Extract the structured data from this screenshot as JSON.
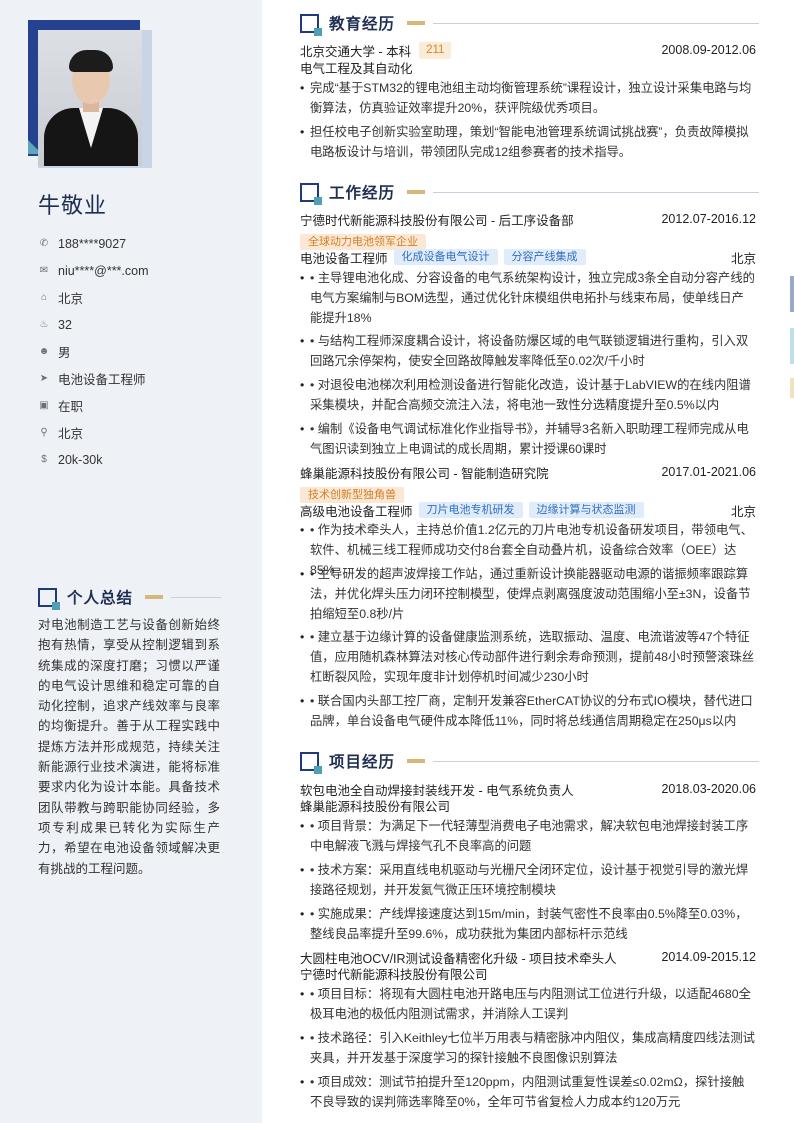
{
  "profile": {
    "name": "牛敬业",
    "info": [
      {
        "icon": "phone-icon",
        "glyph": "✆",
        "text": "188****9027"
      },
      {
        "icon": "mail-icon",
        "glyph": "✉",
        "text": "niu****@***.com"
      },
      {
        "icon": "home-icon",
        "glyph": "⌂",
        "text": "北京"
      },
      {
        "icon": "cake-icon",
        "glyph": "♨",
        "text": "32"
      },
      {
        "icon": "gender-icon",
        "glyph": "☻",
        "text": "男"
      },
      {
        "icon": "send-icon",
        "glyph": "➤",
        "text": "电池设备工程师"
      },
      {
        "icon": "briefcase-icon",
        "glyph": "▣",
        "text": "在职"
      },
      {
        "icon": "location-icon",
        "glyph": "⚲",
        "text": "北京"
      },
      {
        "icon": "salary-icon",
        "glyph": "$",
        "text": "20k-30k"
      }
    ]
  },
  "summary": {
    "title": "个人总结",
    "text": "对电池制造工艺与设备创新始终抱有热情，享受从控制逻辑到系统集成的深度打磨；习惯以严谨的电气设计思维和稳定可靠的自动化控制，追求产线效率与良率的均衡提升。善于从工程实践中提炼方法并形成规范，持续关注新能源行业技术演进，能将标准要求内化为设计本能。具备技术团队带教与跨职能协同经验，多项专利成果已转化为实际生产力，希望在电池设备领域解决更有挑战的工程问题。"
  },
  "education": {
    "title": "教育经历",
    "school": "北京交通大学 - 本科",
    "tag": "211",
    "date": "2008.09-2012.06",
    "major": "电气工程及其自动化",
    "bullets": [
      "完成“基于STM32的锂电池组主动均衡管理系统”课程设计，独立设计采集电路与均衡算法，仿真验证效率提升20%，获评院级优秀项目。",
      "担任校电子创新实验室助理，策划“智能电池管理系统调试挑战赛”，负责故障模拟电路板设计与培训，带领团队完成12组参赛者的技术指导。"
    ]
  },
  "work": {
    "title": "工作经历",
    "jobs": [
      {
        "company": "宁德时代新能源科技股份有限公司 - 后工序设备部",
        "date": "2012.07-2016.12",
        "company_tag": "全球动力电池领军企业",
        "role": "电池设备工程师",
        "skills": [
          "化成设备电气设计",
          "分容产线集成"
        ],
        "city": "北京",
        "bullets": [
          "• 主导锂电池化成、分容设备的电气系统架构设计，独立完成3条全自动分容产线的电气方案编制与BOM选型，通过优化针床模组供电拓扑与线束布局，使单线日产能提升18%",
          "• 与结构工程师深度耦合设计，将设备防爆区域的电气联锁逻辑进行重构，引入双回路冗余停架构，使安全回路故障触发率降低至0.02次/千小时",
          "• 对退役电池梯次利用检测设备进行智能化改造，设计基于LabVIEW的在线内阻谱采集模块，并配合高频交流注入法，将电池一致性分选精度提升至0.5%以内",
          "• 编制《设备电气调试标准化作业指导书》，并辅导3名新入职助理工程师完成从电气图识读到独立上电调试的成长周期，累计授课60课时"
        ]
      },
      {
        "company": "蜂巢能源科技股份有限公司 - 智能制造研究院",
        "date": "2017.01-2021.06",
        "company_tag": "技术创新型独角兽",
        "role": "高级电池设备工程师",
        "skills": [
          "刀片电池专机研发",
          "边缘计算与状态监测"
        ],
        "city": "北京",
        "bullets": [
          "• 作为技术牵头人，主持总价值1.2亿元的刀片电池专机设备研发项目，带领电气、软件、机械三线工程师成功交付8台套全自动叠片机，设备综合效率（OEE）达85%",
          "• 主导研发的超声波焊接工作站，通过重新设计换能器驱动电源的谐振频率跟踪算法，并优化焊头压力闭环控制模型，使焊点剥离强度波动范围缩小至±3N，设备节拍缩短至0.8秒/片",
          "• 建立基于边缘计算的设备健康监测系统，选取振动、温度、电流谐波等47个特征值，应用随机森林算法对核心传动部件进行剩余寿命预测，提前48小时预警滚珠丝杠断裂风险，实现年度非计划停机时间减少230小时",
          "• 联合国内头部工控厂商，定制开发兼容EtherCAT协议的分布式IO模块，替代进口品牌，单台设备电气硬件成本降低11%，同时将总线通信周期稳定在250μs以内"
        ]
      }
    ]
  },
  "projects": {
    "title": "项目经历",
    "items": [
      {
        "name": "软包电池全自动焊接封装线开发 - 电气系统负责人",
        "date": "2018.03-2020.06",
        "org": "蜂巢能源科技股份有限公司",
        "bullets": [
          "• 项目背景：为满足下一代轻薄型消费电子电池需求，解决软包电池焊接封装工序中电解液飞溅与焊接气孔不良率高的问题",
          "• 技术方案：采用直线电机驱动与光栅尺全闭环定位，设计基于视觉引导的激光焊接路径规划，并开发氦气微正压环境控制模块",
          "• 实施成果：产线焊接速度达到15m/min，封装气密性不良率由0.5%降至0.03%，整线良品率提升至99.6%，成功获批为集团内部标杆示范线"
        ]
      },
      {
        "name": "大圆柱电池OCV/IR测试设备精密化升级 - 项目技术牵头人",
        "date": "2014.09-2015.12",
        "org": "宁德时代新能源科技股份有限公司",
        "bullets": [
          "• 项目目标：将现有大圆柱电池开路电压与内阻测试工位进行升级，以适配4680全极耳电池的极低内阻测试需求，并消除人工误判",
          "• 技术路径：引入Keithley七位半万用表与精密脉冲内阻仪，集成高精度四线法测试夹具，并开发基于深度学习的探针接触不良图像识别算法",
          "• 项目成效：测试节拍提升至120ppm，内阻测试重复性误差≤0.02mΩ，探针接触不良导致的误判筛选率降至0%，全年可节省复检人力成本约120万元"
        ]
      }
    ]
  },
  "colors": {
    "navy": "#1f3b7c",
    "teal": "#4f9fb5",
    "gold": "#d6b77a",
    "sidebar": "#eef1f6"
  }
}
